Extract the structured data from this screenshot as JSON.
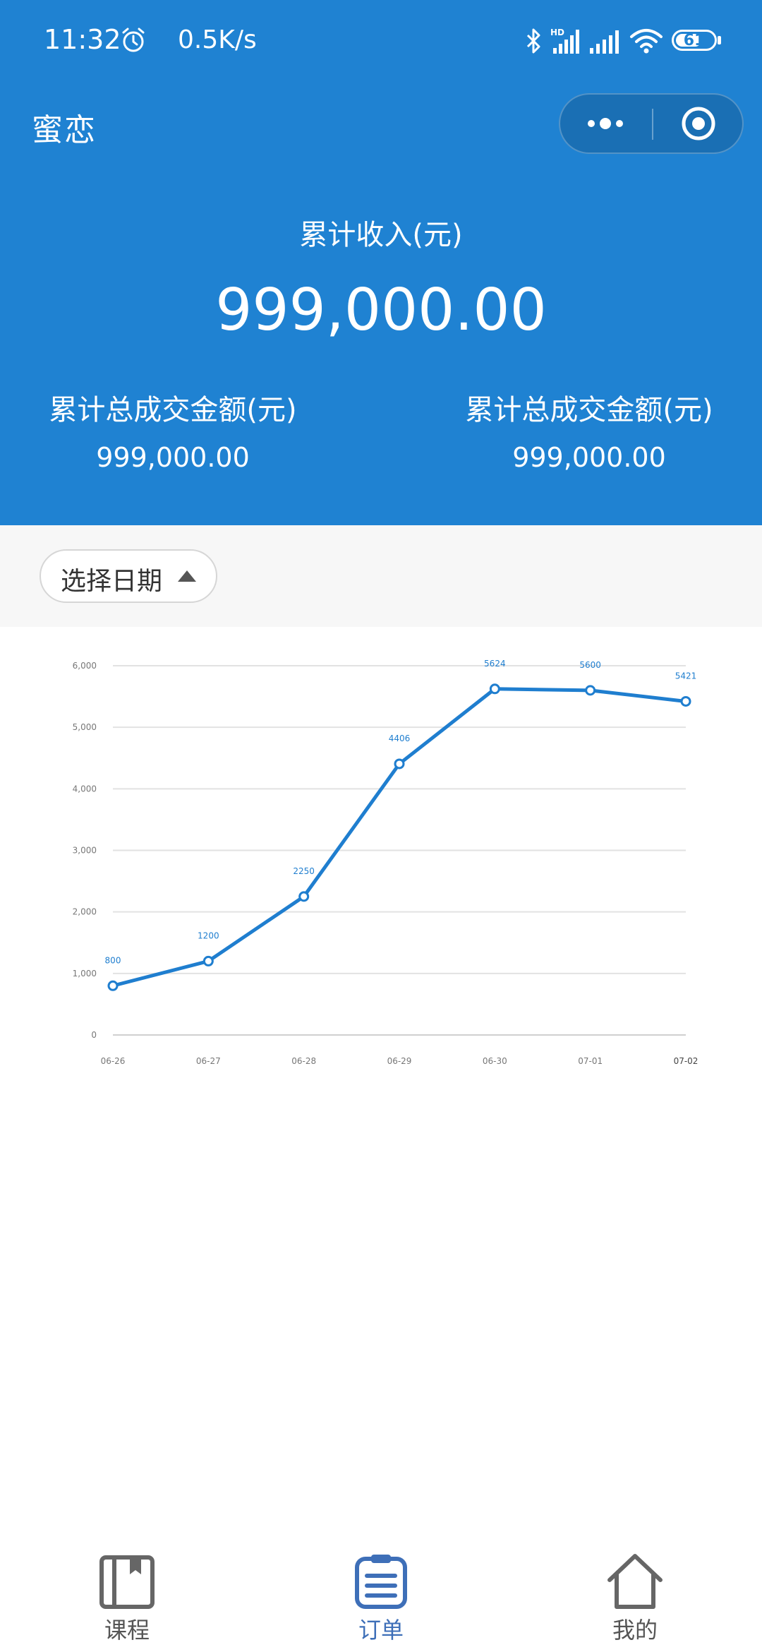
{
  "status_bar": {
    "time": "11:32",
    "net_speed": "0.5K/s",
    "battery": "61"
  },
  "nav": {
    "title": "蜜恋"
  },
  "summary": {
    "income_label": "累计收入(元)",
    "income_value": "999,000.00",
    "left_label": "累计总成交金额(元)",
    "left_value": "999,000.00",
    "right_label": "累计总成交金额(元)",
    "right_value": "999,000.00"
  },
  "filter": {
    "date_label": "选择日期"
  },
  "colors": {
    "header_bg": "#1f82d2",
    "line": "#1f7ecf",
    "tab_active": "#3e6fb8",
    "tab_inactive": "#666666"
  },
  "chart_data": {
    "type": "line",
    "categories": [
      "06-26",
      "06-27",
      "06-28",
      "06-29",
      "06-30",
      "07-01",
      "07-02"
    ],
    "values": [
      800,
      1200,
      2250,
      4406,
      5624,
      5600,
      5421
    ],
    "y_ticks": [
      "0",
      "1,000",
      "2,000",
      "3,000",
      "4,000",
      "5,000",
      "6,000"
    ],
    "ylim": [
      0,
      6000
    ],
    "grid": true
  },
  "tabs": [
    {
      "label": "课程",
      "icon": "book-icon",
      "active": false
    },
    {
      "label": "订单",
      "icon": "order-list-icon",
      "active": true
    },
    {
      "label": "我的",
      "icon": "home-icon",
      "active": false
    }
  ]
}
